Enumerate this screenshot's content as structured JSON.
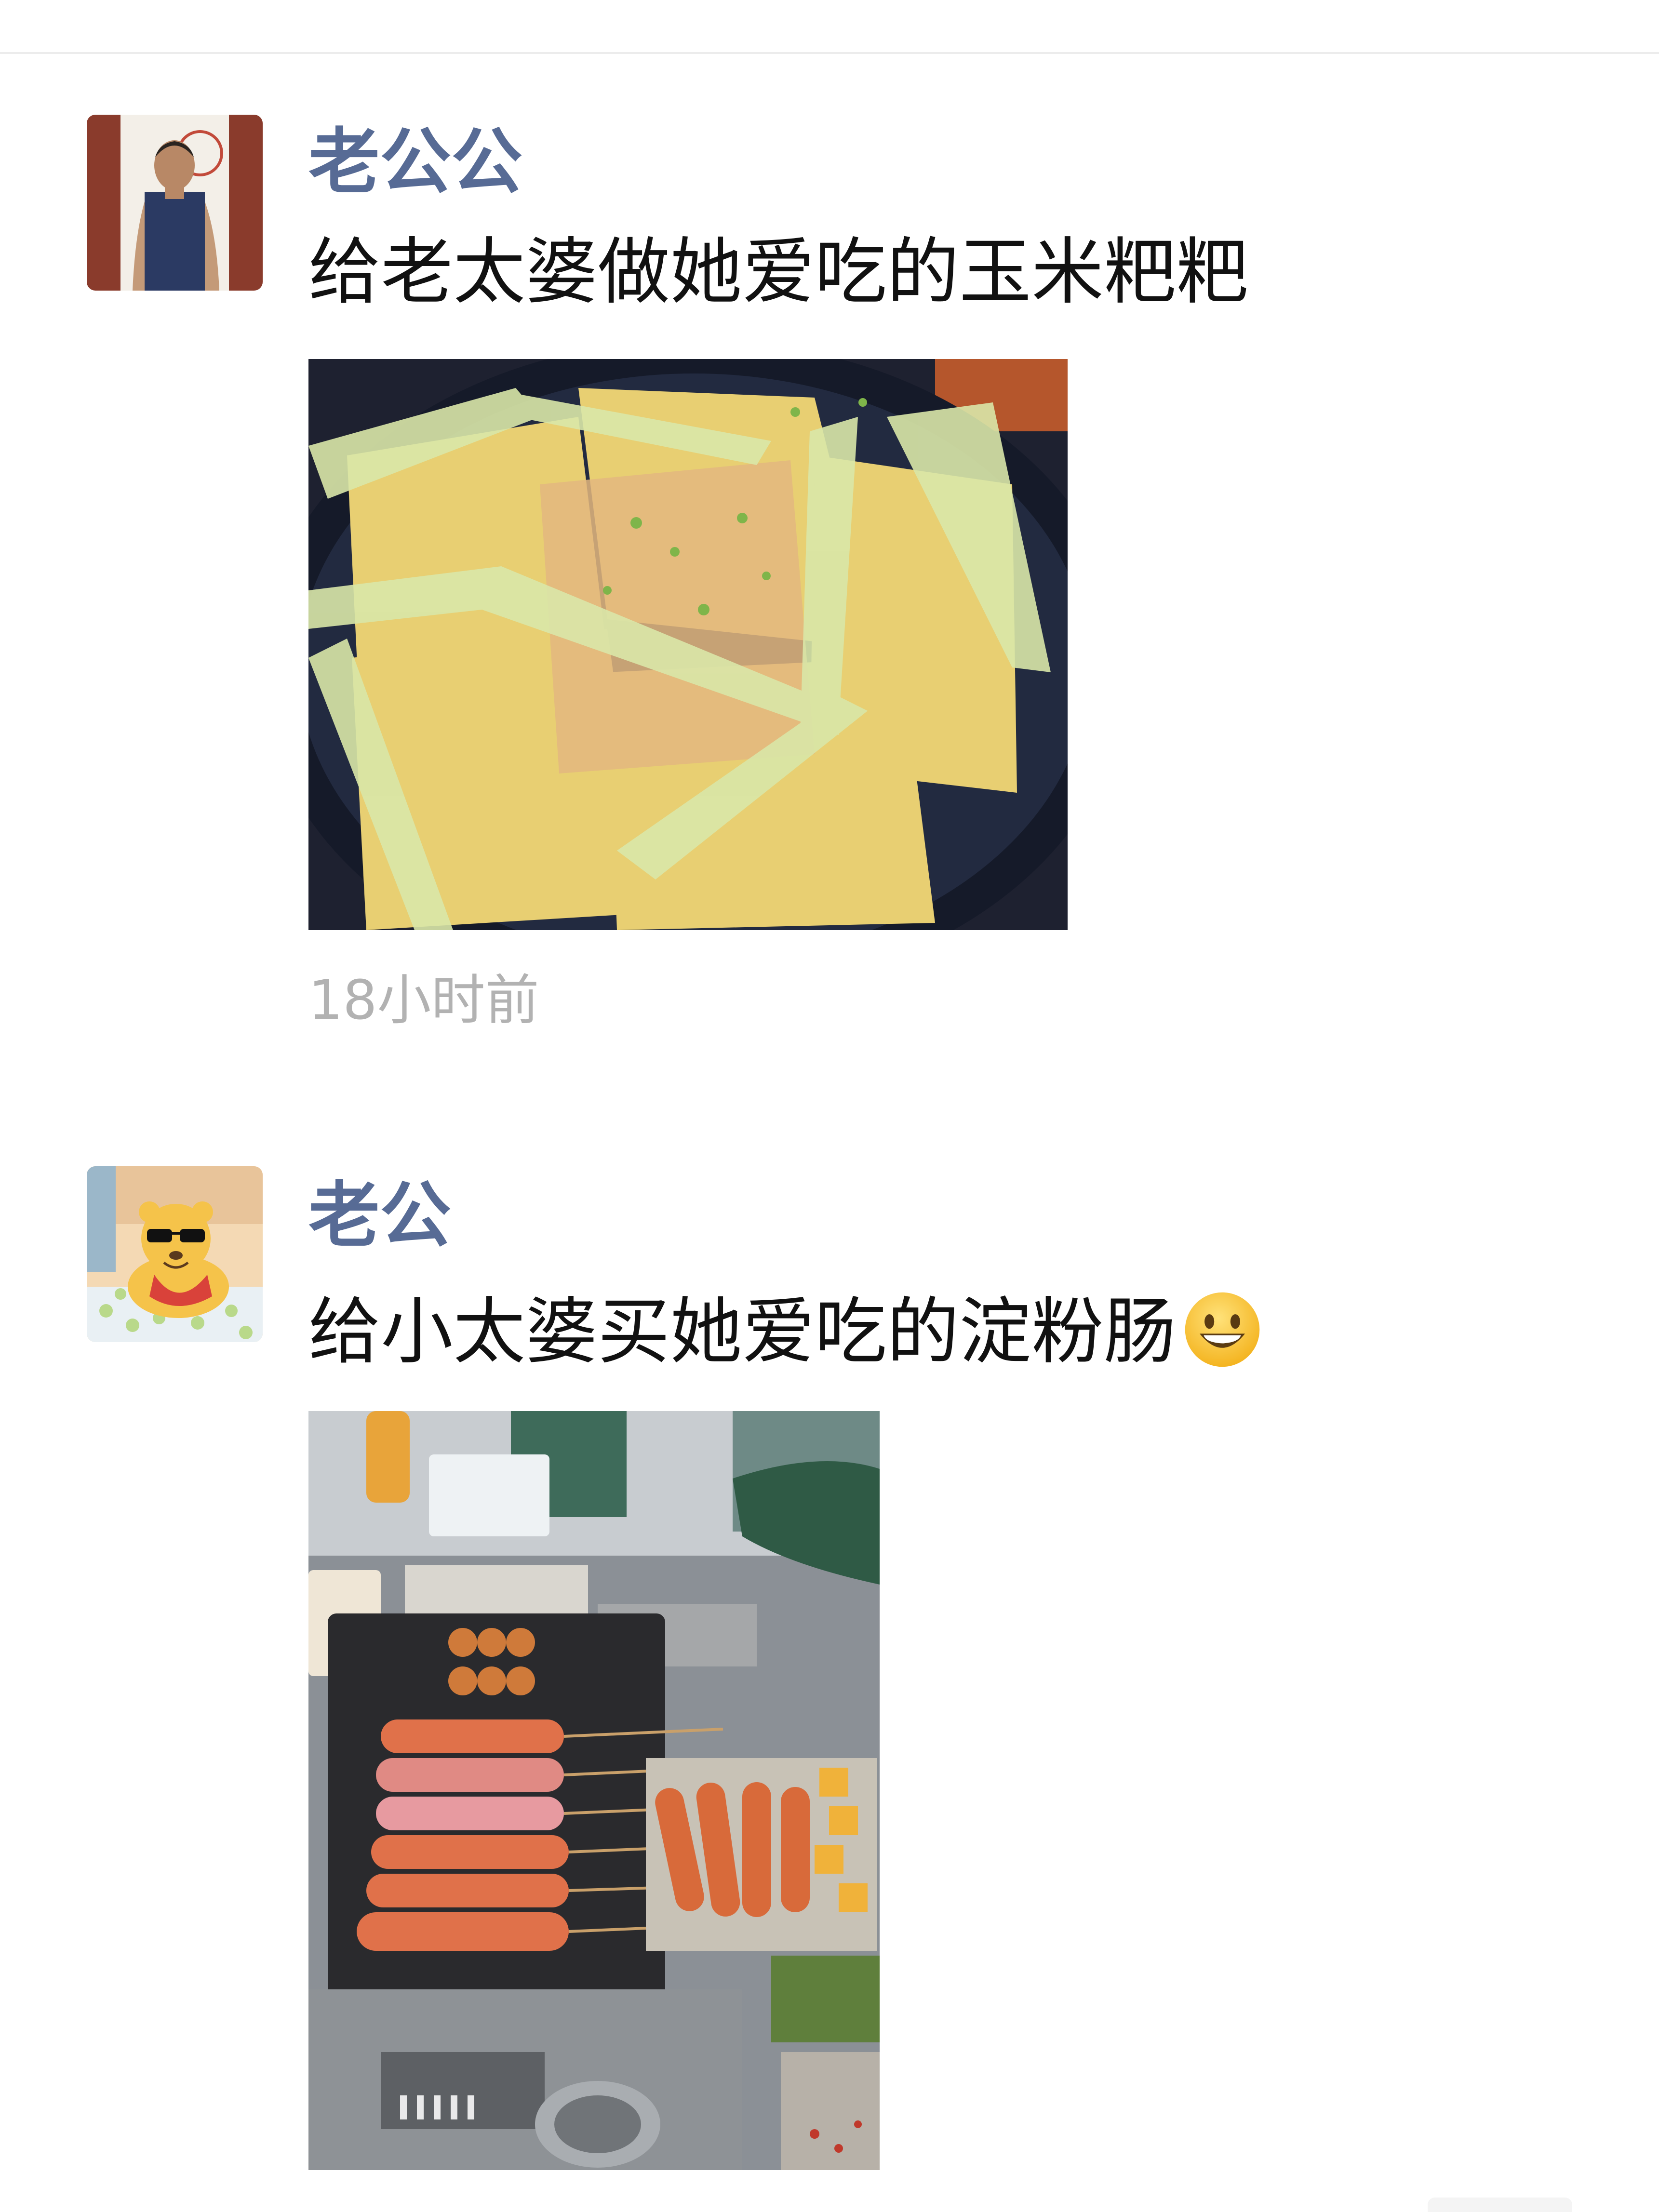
{
  "feed": {
    "posts": [
      {
        "author": "老公公",
        "text": "给老太婆做她爱吃的玉米粑粑",
        "timestamp": "18小时前",
        "avatar_icon": "man-portrait-avatar",
        "photo_subject": "corn-cakes-photo"
      },
      {
        "author": "老公",
        "text": "给小太婆买她爱吃的淀粉肠",
        "emoji": "grinning-face-emoji",
        "avatar_icon": "cartoon-bear-avatar",
        "photo_subject": "grilled-sausages-photo"
      }
    ]
  },
  "colors": {
    "username": "#576b95",
    "text": "#111111",
    "timestamp": "#b2b2b2"
  }
}
